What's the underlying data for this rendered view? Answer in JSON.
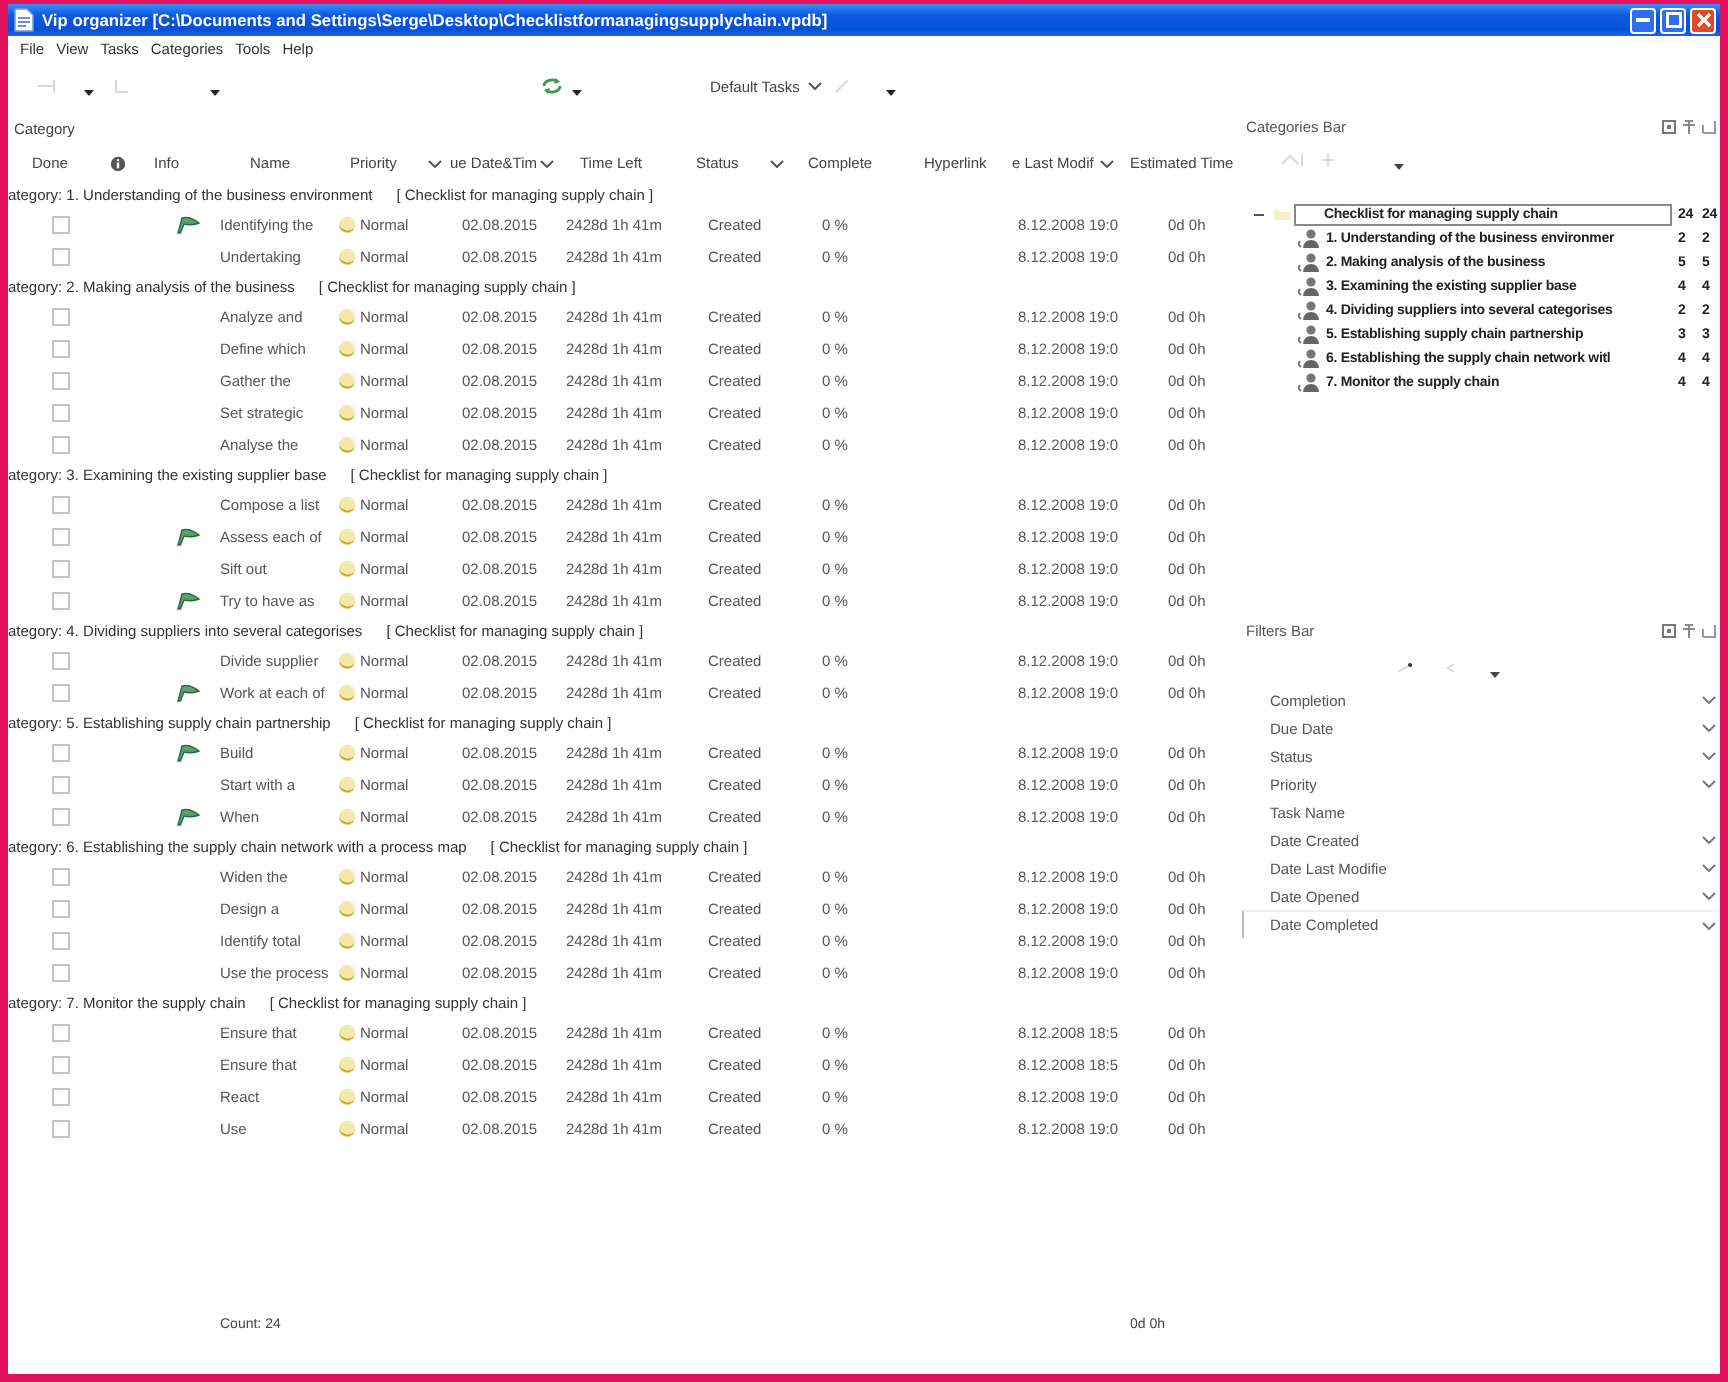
{
  "window": {
    "title": "Vip organizer [C:\\Documents and Settings\\Serge\\Desktop\\Checklistformanagingsupplychain.vpdb]"
  },
  "menu": [
    "File",
    "View",
    "Tasks",
    "Categories",
    "Tools",
    "Help"
  ],
  "toolbar": {
    "view": "Default Tasks"
  },
  "group_by": "Category",
  "table": {
    "columns": [
      {
        "kind": "text",
        "label": "Done",
        "dropdown": false
      },
      {
        "kind": "icon",
        "dropdown": false
      },
      {
        "kind": "text",
        "label": "Info",
        "dropdown": false
      },
      {
        "kind": "text",
        "label": "Name",
        "dropdown": false
      },
      {
        "kind": "text",
        "label": "Priority",
        "dropdown": true
      },
      {
        "kind": "text",
        "label": "ue Date&Tim",
        "dropdown": true
      },
      {
        "kind": "text",
        "label": "Time Left",
        "dropdown": false
      },
      {
        "kind": "text",
        "label": "Status",
        "dropdown": true
      },
      {
        "kind": "text",
        "label": "Complete",
        "dropdown": false
      },
      {
        "kind": "text",
        "label": "Hyperlink",
        "dropdown": false
      },
      {
        "kind": "text",
        "label": "e Last Modif",
        "dropdown": true
      },
      {
        "kind": "text",
        "label": "Estimated Time",
        "dropdown": false
      }
    ],
    "groups": [
      {
        "label": "ategory: 1. Understanding of the business environment",
        "project": "[ Checklist for managing supply chain ]",
        "tasks": [
          {
            "done": false,
            "flagged": true,
            "name": "Identifying the",
            "priority": "Normal",
            "due": "02.08.2015",
            "time_left": "2428d 1h 41m",
            "status": "Created",
            "complete": "0 %",
            "modified": "8.12.2008 19:0",
            "estimated": "0d 0h"
          },
          {
            "done": false,
            "flagged": false,
            "name": "Undertaking",
            "priority": "Normal",
            "due": "02.08.2015",
            "time_left": "2428d 1h 41m",
            "status": "Created",
            "complete": "0 %",
            "modified": "8.12.2008 19:0",
            "estimated": "0d 0h"
          }
        ]
      },
      {
        "label": "ategory: 2. Making analysis of the business",
        "project": "[ Checklist for managing supply chain ]",
        "tasks": [
          {
            "done": false,
            "flagged": false,
            "name": "Analyze and",
            "priority": "Normal",
            "due": "02.08.2015",
            "time_left": "2428d 1h 41m",
            "status": "Created",
            "complete": "0 %",
            "modified": "8.12.2008 19:0",
            "estimated": "0d 0h"
          },
          {
            "done": false,
            "flagged": false,
            "name": "Define which",
            "priority": "Normal",
            "due": "02.08.2015",
            "time_left": "2428d 1h 41m",
            "status": "Created",
            "complete": "0 %",
            "modified": "8.12.2008 19:0",
            "estimated": "0d 0h"
          },
          {
            "done": false,
            "flagged": false,
            "name": "Gather the",
            "priority": "Normal",
            "due": "02.08.2015",
            "time_left": "2428d 1h 41m",
            "status": "Created",
            "complete": "0 %",
            "modified": "8.12.2008 19:0",
            "estimated": "0d 0h"
          },
          {
            "done": false,
            "flagged": false,
            "name": "Set strategic",
            "priority": "Normal",
            "due": "02.08.2015",
            "time_left": "2428d 1h 41m",
            "status": "Created",
            "complete": "0 %",
            "modified": "8.12.2008 19:0",
            "estimated": "0d 0h"
          },
          {
            "done": false,
            "flagged": false,
            "name": "Analyse the",
            "priority": "Normal",
            "due": "02.08.2015",
            "time_left": "2428d 1h 41m",
            "status": "Created",
            "complete": "0 %",
            "modified": "8.12.2008 19:0",
            "estimated": "0d 0h"
          }
        ]
      },
      {
        "label": "ategory: 3. Examining the existing supplier base",
        "project": "[ Checklist for managing supply chain ]",
        "tasks": [
          {
            "done": false,
            "flagged": false,
            "name": "Compose a list",
            "priority": "Normal",
            "due": "02.08.2015",
            "time_left": "2428d 1h 41m",
            "status": "Created",
            "complete": "0 %",
            "modified": "8.12.2008 19:0",
            "estimated": "0d 0h"
          },
          {
            "done": false,
            "flagged": true,
            "name": "Assess each of",
            "priority": "Normal",
            "due": "02.08.2015",
            "time_left": "2428d 1h 41m",
            "status": "Created",
            "complete": "0 %",
            "modified": "8.12.2008 19:0",
            "estimated": "0d 0h"
          },
          {
            "done": false,
            "flagged": false,
            "name": "Sift out",
            "priority": "Normal",
            "due": "02.08.2015",
            "time_left": "2428d 1h 41m",
            "status": "Created",
            "complete": "0 %",
            "modified": "8.12.2008 19:0",
            "estimated": "0d 0h"
          },
          {
            "done": false,
            "flagged": true,
            "name": "Try to have as",
            "priority": "Normal",
            "due": "02.08.2015",
            "time_left": "2428d 1h 41m",
            "status": "Created",
            "complete": "0 %",
            "modified": "8.12.2008 19:0",
            "estimated": "0d 0h"
          }
        ]
      },
      {
        "label": "ategory: 4. Dividing suppliers into several categorises",
        "project": "[ Checklist for managing supply chain ]",
        "tasks": [
          {
            "done": false,
            "flagged": false,
            "name": "Divide supplier",
            "priority": "Normal",
            "due": "02.08.2015",
            "time_left": "2428d 1h 41m",
            "status": "Created",
            "complete": "0 %",
            "modified": "8.12.2008 19:0",
            "estimated": "0d 0h"
          },
          {
            "done": false,
            "flagged": true,
            "name": "Work at each of",
            "priority": "Normal",
            "due": "02.08.2015",
            "time_left": "2428d 1h 41m",
            "status": "Created",
            "complete": "0 %",
            "modified": "8.12.2008 19:0",
            "estimated": "0d 0h"
          }
        ]
      },
      {
        "label": "ategory: 5. Establishing supply chain partnership",
        "project": "[ Checklist for managing supply chain ]",
        "tasks": [
          {
            "done": false,
            "flagged": true,
            "name": "Build",
            "priority": "Normal",
            "due": "02.08.2015",
            "time_left": "2428d 1h 41m",
            "status": "Created",
            "complete": "0 %",
            "modified": "8.12.2008 19:0",
            "estimated": "0d 0h"
          },
          {
            "done": false,
            "flagged": false,
            "name": "Start with a",
            "priority": "Normal",
            "due": "02.08.2015",
            "time_left": "2428d 1h 41m",
            "status": "Created",
            "complete": "0 %",
            "modified": "8.12.2008 19:0",
            "estimated": "0d 0h"
          },
          {
            "done": false,
            "flagged": true,
            "name": "When",
            "priority": "Normal",
            "due": "02.08.2015",
            "time_left": "2428d 1h 41m",
            "status": "Created",
            "complete": "0 %",
            "modified": "8.12.2008 19:0",
            "estimated": "0d 0h"
          }
        ]
      },
      {
        "label": "ategory: 6. Establishing the supply chain network with a process map",
        "project": "[ Checklist for managing supply chain ]",
        "tasks": [
          {
            "done": false,
            "flagged": false,
            "name": "Widen the",
            "priority": "Normal",
            "due": "02.08.2015",
            "time_left": "2428d 1h 41m",
            "status": "Created",
            "complete": "0 %",
            "modified": "8.12.2008 19:0",
            "estimated": "0d 0h"
          },
          {
            "done": false,
            "flagged": false,
            "name": "Design a",
            "priority": "Normal",
            "due": "02.08.2015",
            "time_left": "2428d 1h 41m",
            "status": "Created",
            "complete": "0 %",
            "modified": "8.12.2008 19:0",
            "estimated": "0d 0h"
          },
          {
            "done": false,
            "flagged": false,
            "name": "Identify total",
            "priority": "Normal",
            "due": "02.08.2015",
            "time_left": "2428d 1h 41m",
            "status": "Created",
            "complete": "0 %",
            "modified": "8.12.2008 19:0",
            "estimated": "0d 0h"
          },
          {
            "done": false,
            "flagged": false,
            "name": "Use the process",
            "priority": "Normal",
            "due": "02.08.2015",
            "time_left": "2428d 1h 41m",
            "status": "Created",
            "complete": "0 %",
            "modified": "8.12.2008 19:0",
            "estimated": "0d 0h"
          }
        ]
      },
      {
        "label": "ategory: 7. Monitor the supply chain",
        "project": "[ Checklist for managing supply chain ]",
        "tasks": [
          {
            "done": false,
            "flagged": false,
            "name": "Ensure that",
            "priority": "Normal",
            "due": "02.08.2015",
            "time_left": "2428d 1h 41m",
            "status": "Created",
            "complete": "0 %",
            "modified": "8.12.2008 18:5",
            "estimated": "0d 0h"
          },
          {
            "done": false,
            "flagged": false,
            "name": "Ensure that",
            "priority": "Normal",
            "due": "02.08.2015",
            "time_left": "2428d 1h 41m",
            "status": "Created",
            "complete": "0 %",
            "modified": "8.12.2008 18:5",
            "estimated": "0d 0h"
          },
          {
            "done": false,
            "flagged": false,
            "name": "React",
            "priority": "Normal",
            "due": "02.08.2015",
            "time_left": "2428d 1h 41m",
            "status": "Created",
            "complete": "0 %",
            "modified": "8.12.2008 19:0",
            "estimated": "0d 0h"
          },
          {
            "done": false,
            "flagged": false,
            "name": "Use",
            "priority": "Normal",
            "due": "02.08.2015",
            "time_left": "2428d 1h 41m",
            "status": "Created",
            "complete": "0 %",
            "modified": "8.12.2008 19:0",
            "estimated": "0d 0h"
          }
        ]
      }
    ]
  },
  "footer": {
    "count": "Count: 24",
    "estimated_total": "0d 0h"
  },
  "categories_bar": {
    "title": "Categories Bar",
    "root": {
      "label": "Checklist for managing supply chain",
      "count_1": "24",
      "count_2": "24",
      "expanded": true,
      "selected": true,
      "children": [
        {
          "label": "1. Understanding of the business environmer",
          "count_1": "2",
          "count_2": "2",
          "selected": false
        },
        {
          "label": "2. Making analysis of the business",
          "count_1": "5",
          "count_2": "5",
          "selected": false
        },
        {
          "label": "3. Examining the existing supplier base",
          "count_1": "4",
          "count_2": "4",
          "selected": false
        },
        {
          "label": "4. Dividing suppliers into several categorises",
          "count_1": "2",
          "count_2": "2",
          "selected": false
        },
        {
          "label": "5. Establishing supply chain partnership",
          "count_1": "3",
          "count_2": "3",
          "selected": false
        },
        {
          "label": "6. Establishing the supply chain network witl",
          "count_1": "4",
          "count_2": "4",
          "selected": false
        },
        {
          "label": "7. Monitor the supply chain",
          "count_1": "4",
          "count_2": "4",
          "selected": false
        }
      ]
    }
  },
  "filters_bar": {
    "title": "Filters Bar",
    "items": [
      {
        "label": "Completion",
        "dropdown": true,
        "selected": false
      },
      {
        "label": "Due Date",
        "dropdown": true,
        "selected": false
      },
      {
        "label": "Status",
        "dropdown": true,
        "selected": false
      },
      {
        "label": "Priority",
        "dropdown": true,
        "selected": false
      },
      {
        "label": "Task Name",
        "dropdown": false,
        "selected": false
      },
      {
        "label": "Date Created",
        "dropdown": true,
        "selected": false
      },
      {
        "label": "Date Last Modifie",
        "dropdown": true,
        "selected": false
      },
      {
        "label": "Date Opened",
        "dropdown": true,
        "selected": false
      },
      {
        "label": "Date Completed",
        "dropdown": true,
        "selected": true
      }
    ]
  }
}
